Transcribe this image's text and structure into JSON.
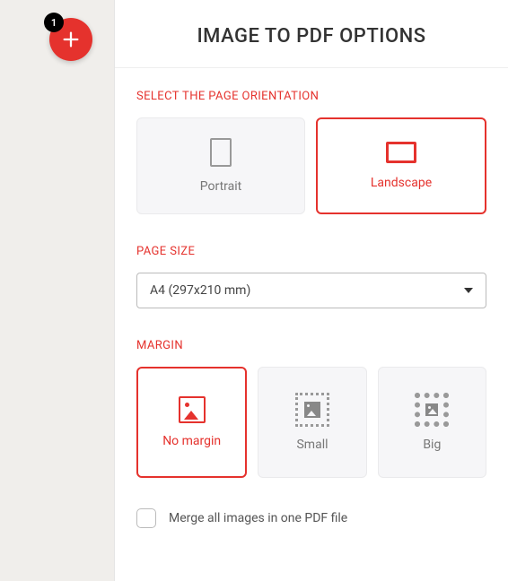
{
  "left": {
    "badge_count": "1"
  },
  "panel": {
    "title": "IMAGE TO PDF OPTIONS"
  },
  "orientation": {
    "label": "SELECT THE PAGE ORIENTATION",
    "portrait": "Portrait",
    "landscape": "Landscape",
    "selected": "landscape"
  },
  "pagesize": {
    "label": "PAGE SIZE",
    "value": "A4 (297x210 mm)"
  },
  "margin": {
    "label": "MARGIN",
    "none": "No margin",
    "small": "Small",
    "big": "Big",
    "selected": "none"
  },
  "merge": {
    "label": "Merge all images in one PDF file",
    "checked": false
  }
}
